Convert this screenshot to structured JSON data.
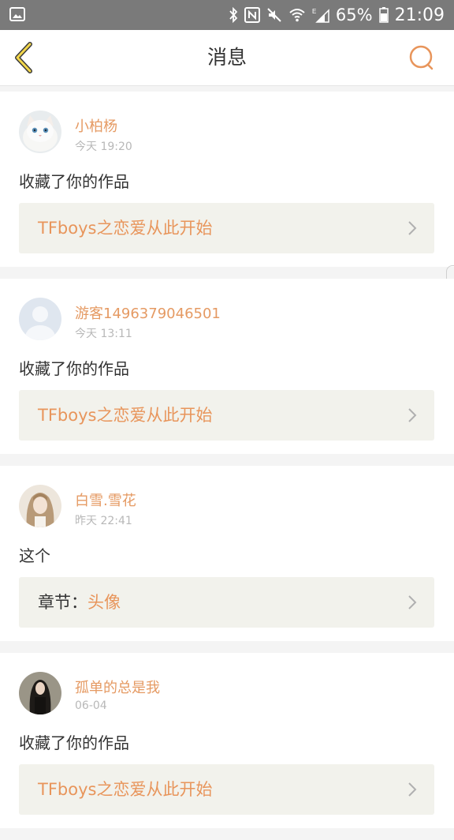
{
  "status": {
    "battery_percent": "65%",
    "time": "21:09"
  },
  "header": {
    "title": "消息"
  },
  "messages": [
    {
      "name": "小柏杨",
      "time": "今天 19:20",
      "action": "收藏了你的作品",
      "work_prefix": "",
      "work_title": "TFboys之恋爱从此开始"
    },
    {
      "name": "游客1496379046501",
      "time": "今天 13:11",
      "action": "收藏了你的作品",
      "work_prefix": "",
      "work_title": "TFboys之恋爱从此开始"
    },
    {
      "name": "白雪.雪花",
      "time": "昨天 22:41",
      "action": "这个",
      "work_prefix": "章节：",
      "work_title": "头像"
    },
    {
      "name": "孤单的总是我",
      "time": "06-04",
      "action": "收藏了你的作品",
      "work_prefix": "",
      "work_title": "TFboys之恋爱从此开始"
    }
  ],
  "colors": {
    "accent": "#e8955b",
    "card_bg": "#f2f2ec",
    "status_bar": "#7a7a7a"
  },
  "icons": {
    "back": "chevron-left-icon",
    "search": "search-icon"
  }
}
